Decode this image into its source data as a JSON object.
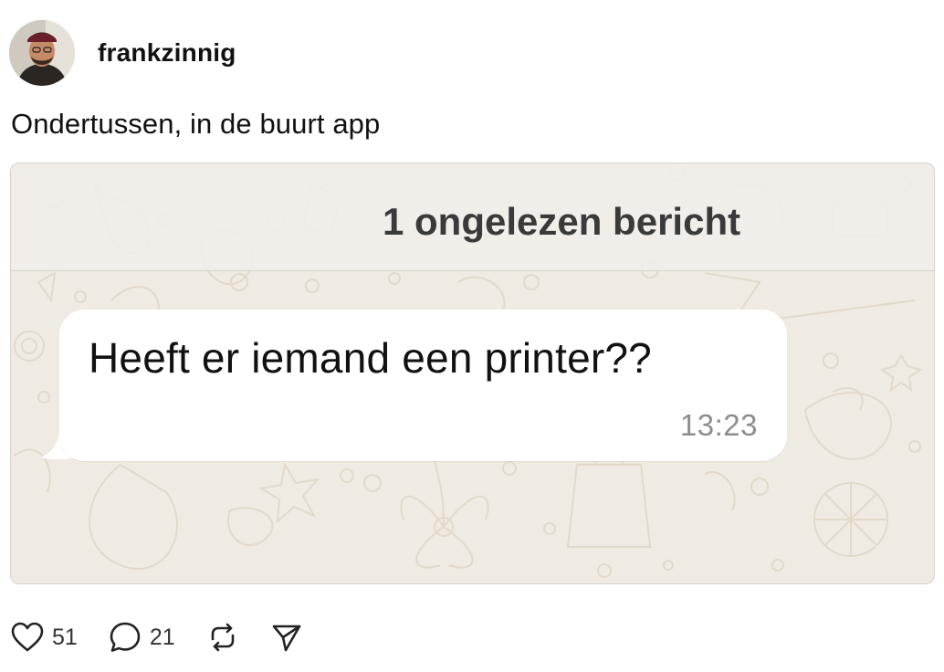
{
  "post": {
    "username": "frankzinnig",
    "caption": "Ondertussen, in de buurt app",
    "avatar_icon": "profile-photo"
  },
  "media": {
    "unread_banner": "1 ongelezen bericht",
    "message_text": "Heeft er iemand een printer??",
    "message_time": "13:23",
    "background_color": "#efeae2",
    "bubble_color": "#ffffff"
  },
  "actions": {
    "likes": "51",
    "comments": "21",
    "like_icon": "heart-icon",
    "comment_icon": "speech-bubble-icon",
    "repost_icon": "repost-icon",
    "share_icon": "paper-plane-icon"
  }
}
